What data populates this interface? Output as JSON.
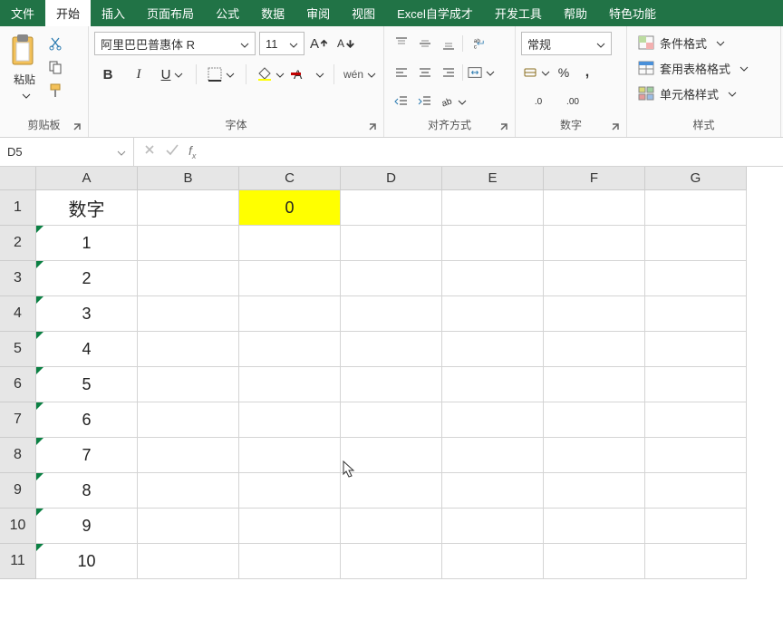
{
  "tabs": [
    "文件",
    "开始",
    "插入",
    "页面布局",
    "公式",
    "数据",
    "审阅",
    "视图",
    "Excel自学成才",
    "开发工具",
    "帮助",
    "特色功能"
  ],
  "active_tab_index": 1,
  "clipboard": {
    "label": "剪贴板",
    "paste_label": "粘贴"
  },
  "font": {
    "label": "字体",
    "family": "阿里巴巴普惠体 R",
    "size": "11"
  },
  "align": {
    "label": "对齐方式"
  },
  "number": {
    "label": "数字",
    "format": "常规"
  },
  "styles": {
    "label": "样式",
    "cond": "条件格式",
    "tablefmt": "套用表格格式",
    "cellstyle": "单元格样式"
  },
  "namebox": "D5",
  "formula": "",
  "columns": [
    "A",
    "B",
    "C",
    "D",
    "E",
    "F",
    "G"
  ],
  "rows": [
    {
      "n": "1",
      "A": "数字",
      "C": "0",
      "chl": true,
      "A_triangle": false,
      "A_header": true
    },
    {
      "n": "2",
      "A": "1",
      "A_triangle": true
    },
    {
      "n": "3",
      "A": "2",
      "A_triangle": true
    },
    {
      "n": "4",
      "A": "3",
      "A_triangle": true
    },
    {
      "n": "5",
      "A": "4",
      "A_triangle": true
    },
    {
      "n": "6",
      "A": "5",
      "A_triangle": true
    },
    {
      "n": "7",
      "A": "6",
      "A_triangle": true
    },
    {
      "n": "8",
      "A": "7",
      "A_triangle": true
    },
    {
      "n": "9",
      "A": "8",
      "A_triangle": true
    },
    {
      "n": "10",
      "A": "9",
      "A_triangle": true
    },
    {
      "n": "11",
      "A": "10",
      "A_triangle": true
    }
  ]
}
